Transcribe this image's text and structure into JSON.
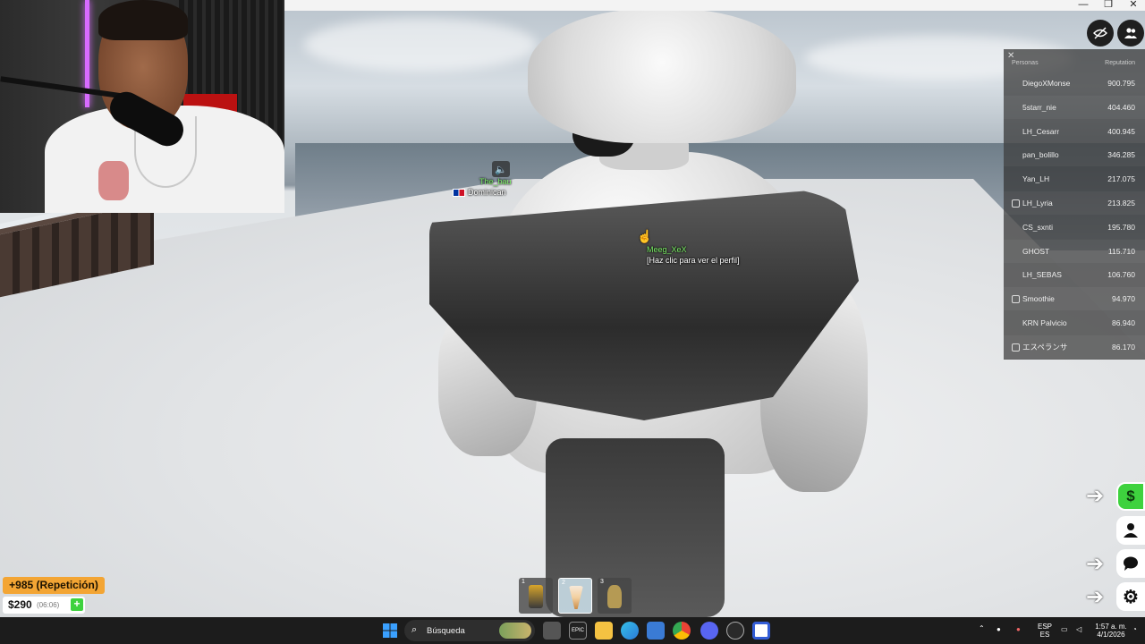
{
  "window": {
    "minimize_label": "—",
    "maximize_label": "❐",
    "close_label": "✕"
  },
  "scene": {
    "nametag_top_name": "The_bau",
    "nametag_top_sub": "Dominican",
    "nametag_player_name": "Meeg_XeX",
    "nametag_player_hint": "[Haz clic para ver el perfil]"
  },
  "top_buttons": {
    "hide_icon": "eye-off-icon",
    "people_icon": "people-icon"
  },
  "leaderboard": {
    "close_label": "✕",
    "col_players": "Personas",
    "col_reputation": "Reputation",
    "rows": [
      {
        "name": "DiegoXMonse",
        "value": "900.795",
        "badge": false
      },
      {
        "name": "5starr_nie",
        "value": "404.460",
        "badge": false
      },
      {
        "name": "LH_Cesarr",
        "value": "400.945",
        "badge": false
      },
      {
        "name": "pan_bolillo",
        "value": "346.285",
        "badge": false
      },
      {
        "name": "Yan_LH",
        "value": "217.075",
        "badge": false
      },
      {
        "name": "LH_Lyria",
        "value": "213.825",
        "badge": true
      },
      {
        "name": "CS_sxnti",
        "value": "195.780",
        "badge": false
      },
      {
        "name": "GHOST",
        "value": "115.710",
        "badge": false
      },
      {
        "name": "LH_SEBAS",
        "value": "106.760",
        "badge": false
      },
      {
        "name": "Smoothie",
        "value": "94.970",
        "badge": true
      },
      {
        "name": "KRN Palvicio",
        "value": "86.940",
        "badge": false
      },
      {
        "name": "エスペランサ",
        "value": "86.170",
        "badge": true
      }
    ]
  },
  "side_buttons": {
    "money_label": "$",
    "arrow": "➔"
  },
  "hotbar": {
    "slots": [
      {
        "num": "1"
      },
      {
        "num": "2"
      },
      {
        "num": "3"
      }
    ]
  },
  "hud": {
    "rep_text": "+985 (Repetición)",
    "money": "$290",
    "timer": "(06:06)",
    "plus": "+"
  },
  "taskbar": {
    "search_placeholder": "Búsqueda",
    "lang_top": "ESP",
    "lang_bottom": "ES",
    "time": "1:57 a. m.",
    "date": "4/1/2026"
  },
  "colors": {
    "money_green": "#3ed23e",
    "rep_orange": "#f3a534",
    "leaderboard_bg": "#323232"
  }
}
